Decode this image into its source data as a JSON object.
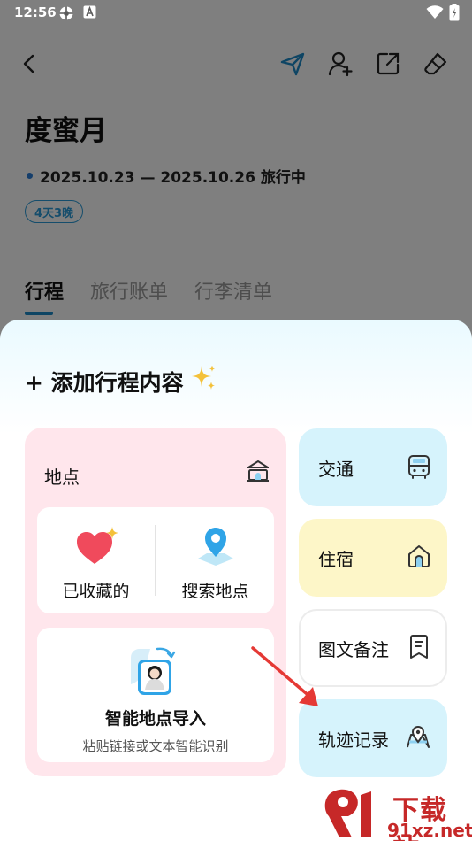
{
  "status_bar": {
    "time": "12:56"
  },
  "trip": {
    "title": "度蜜月",
    "dates": "2025.10.23 — 2025.10.26 旅行中",
    "duration_badge": "4天3晚"
  },
  "tabs": [
    {
      "label": "行程",
      "active": true
    },
    {
      "label": "旅行账单",
      "active": false
    },
    {
      "label": "行李清单",
      "active": false
    }
  ],
  "sheet": {
    "title": "+ 添加行程内容",
    "place": {
      "label": "地点",
      "favorites_label": "已收藏的",
      "search_label": "搜索地点",
      "smart_import_title": "智能地点导入",
      "smart_import_sub": "粘贴链接或文本智能识别"
    },
    "transport_label": "交通",
    "lodging_label": "住宿",
    "note_label": "图文备注",
    "track_label": "轨迹记录"
  },
  "watermark": {
    "line1": "下载站",
    "line2": "91xz.net"
  },
  "colors": {
    "accent": "#1d8ac9",
    "place_bg": "#ffe6ec",
    "transport_bg": "#d6f3fc",
    "lodging_bg": "#fdf6c8",
    "track_bg": "#d6f3fc",
    "arrow": "#e53935"
  }
}
